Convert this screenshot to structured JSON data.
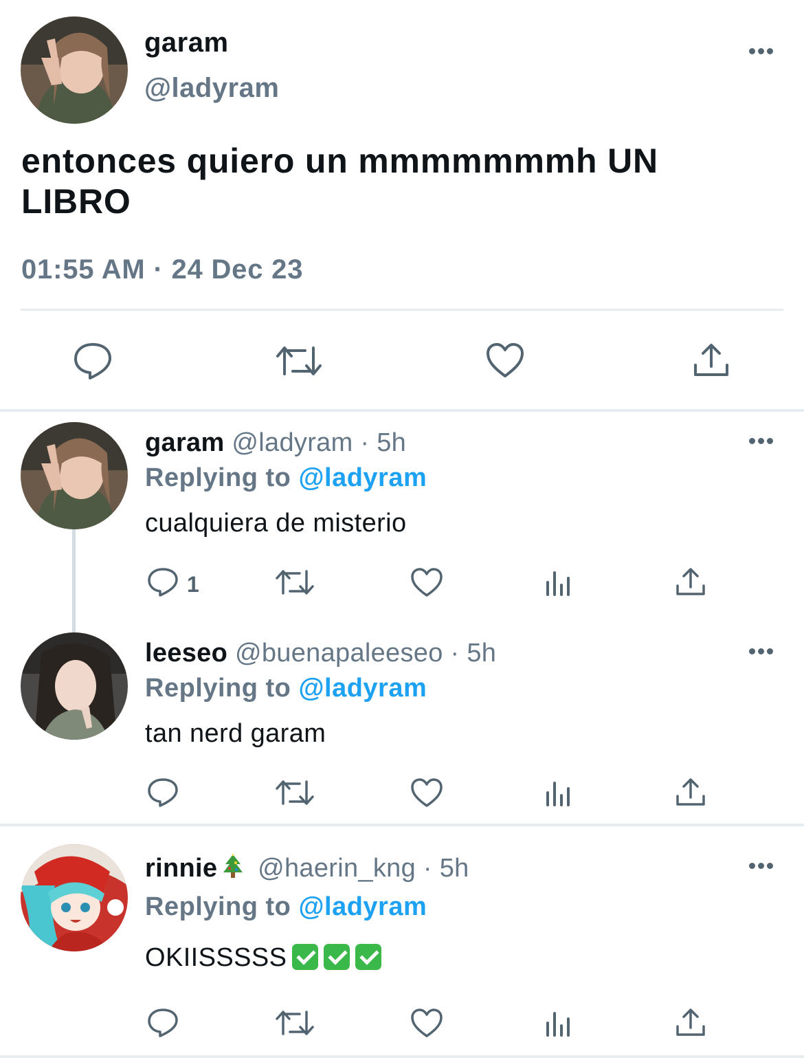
{
  "main_tweet": {
    "name": "garam",
    "handle": "@ladyram",
    "text": "entonces quiero un mmmmmmmh UN LIBRO",
    "timestamp": "01:55 AM · 24 Dec 23"
  },
  "replies": [
    {
      "name": "garam",
      "handle": "@ladyram",
      "time": "· 5h",
      "replying_prefix": "Replying to",
      "replying_to": "@ladyram",
      "text": "cualquiera de misterio",
      "reply_count": "1"
    },
    {
      "name": "leeseo",
      "handle": "@buenapaleeseo",
      "time": "· 5h",
      "replying_prefix": "Replying to",
      "replying_to": "@ladyram",
      "text": "tan nerd garam"
    },
    {
      "name": "rinnie",
      "handle": "@haerin_kng",
      "time": "· 5h",
      "replying_prefix": "Replying to",
      "replying_to": "@ladyram",
      "text": "OKIISSSSS"
    }
  ],
  "colors": {
    "link": "#1da1f2",
    "secondary": "#657786",
    "icon": "#536471",
    "divider": "#e6ecf0"
  }
}
